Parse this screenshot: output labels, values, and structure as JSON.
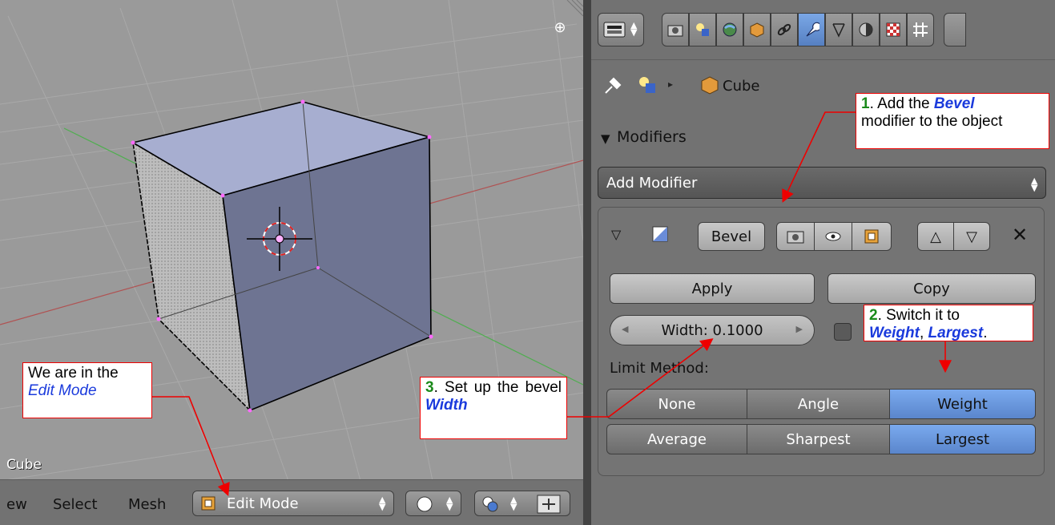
{
  "viewport": {
    "view_name": "Cube",
    "header": {
      "menu_view": "ew",
      "menu_select": "Select",
      "menu_mesh": "Mesh",
      "mode": "Edit Mode"
    }
  },
  "properties": {
    "context_object": "Cube",
    "modifiers_title": "Modifiers",
    "add_modifier": "Add Modifier",
    "modifier": {
      "name": "Bevel",
      "apply": "Apply",
      "copy": "Copy",
      "width_field": "Width: 0.1000",
      "limit_method_label": "Limit Method:",
      "limit_methods": [
        "None",
        "Angle",
        "Weight"
      ],
      "limit_selected": "Weight",
      "width_methods": [
        "Average",
        "Sharpest",
        "Largest"
      ],
      "width_selected": "Largest"
    }
  },
  "callouts": {
    "c1": {
      "num": "1",
      "t1": ". Add the ",
      "key": "Bevel",
      "t2": "modifier to the object"
    },
    "c2": {
      "num": "2",
      "t1": ". Switch it to ",
      "key1": "Weight",
      "sep": ", ",
      "key2": "Largest",
      "t2": "."
    },
    "c3": {
      "num": "3",
      "t1": ". Set up the bevel ",
      "key": "Width"
    },
    "c4": {
      "t1": "We are in the ",
      "key": "Edit Mode"
    }
  },
  "colors": {
    "accent": "#5a86cc",
    "callout_border": "#e00000",
    "callout_number": "#1a8a1a",
    "callout_keyword": "#1a3adc"
  }
}
